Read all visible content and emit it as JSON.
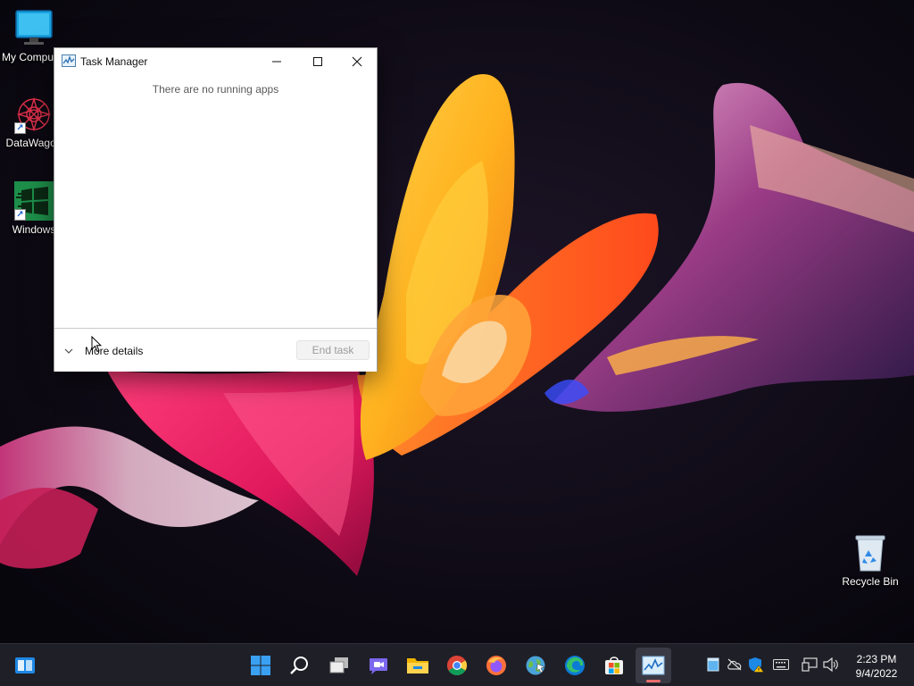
{
  "desktop": {
    "icons": [
      {
        "label": "My Computer",
        "name": "my-computer"
      },
      {
        "label": "DataWagon",
        "name": "datawagon"
      },
      {
        "label": "Windows",
        "name": "windows"
      },
      {
        "label": "Recycle Bin",
        "name": "recycle-bin"
      }
    ]
  },
  "task_manager": {
    "title": "Task Manager",
    "empty_message": "There are no running apps",
    "more_details_label": "More details",
    "end_task_label": "End task",
    "controls": [
      "minimize-icon",
      "maximize-icon",
      "close-icon"
    ]
  },
  "taskbar": {
    "left_widget": "widgets-icon",
    "pinned": [
      {
        "name": "start-button",
        "icon": "windows-logo-icon"
      },
      {
        "name": "search-button",
        "icon": "search-icon"
      },
      {
        "name": "task-view-button",
        "icon": "task-view-icon"
      },
      {
        "name": "chat-button",
        "icon": "chat-icon"
      },
      {
        "name": "file-explorer-button",
        "icon": "folder-icon"
      },
      {
        "name": "chrome-button",
        "icon": "chrome-icon"
      },
      {
        "name": "firefox-button",
        "icon": "firefox-icon"
      },
      {
        "name": "network-tool-button",
        "icon": "globe-icon"
      },
      {
        "name": "edge-button",
        "icon": "edge-icon"
      },
      {
        "name": "store-button",
        "icon": "store-icon"
      },
      {
        "name": "task-manager-button",
        "icon": "task-manager-icon",
        "active": true
      }
    ],
    "tray": [
      "window-icon",
      "cloud-offline-icon",
      "security-warning-icon",
      "keyboard-icon",
      "network-icon",
      "volume-icon"
    ],
    "clock": {
      "time": "2:23 PM",
      "date": "9/4/2022"
    }
  },
  "colors": {
    "taskbar_bg": "#1f1f27",
    "window_bg": "#ffffff",
    "active_indicator": "#e96d6d",
    "accent_blue": "#1e88e5"
  }
}
